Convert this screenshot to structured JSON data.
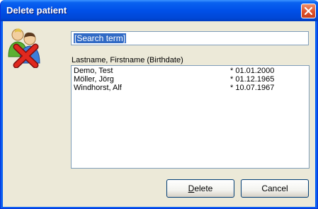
{
  "window": {
    "title": "Delete patient"
  },
  "search": {
    "value": "[Search term]"
  },
  "list": {
    "header": "Lastname, Firstname (Birthdate)",
    "rows": [
      {
        "name": "Demo, Test",
        "birthdate": "* 01.01.2000"
      },
      {
        "name": "Möller, Jörg",
        "birthdate": "* 01.12.1965"
      },
      {
        "name": "Windhorst, Alf",
        "birthdate": "* 10.07.1967"
      }
    ]
  },
  "buttons": {
    "delete_access_key": "D",
    "delete_rest": "elete",
    "cancel": "Cancel"
  },
  "colors": {
    "titlebar": "#0050e8",
    "dialog_bg": "#ece9d8",
    "selection": "#316ac5",
    "delete_x": "#d9241c"
  },
  "icons": {
    "title_close": "close-icon",
    "dialog": "delete-patient-icon"
  }
}
